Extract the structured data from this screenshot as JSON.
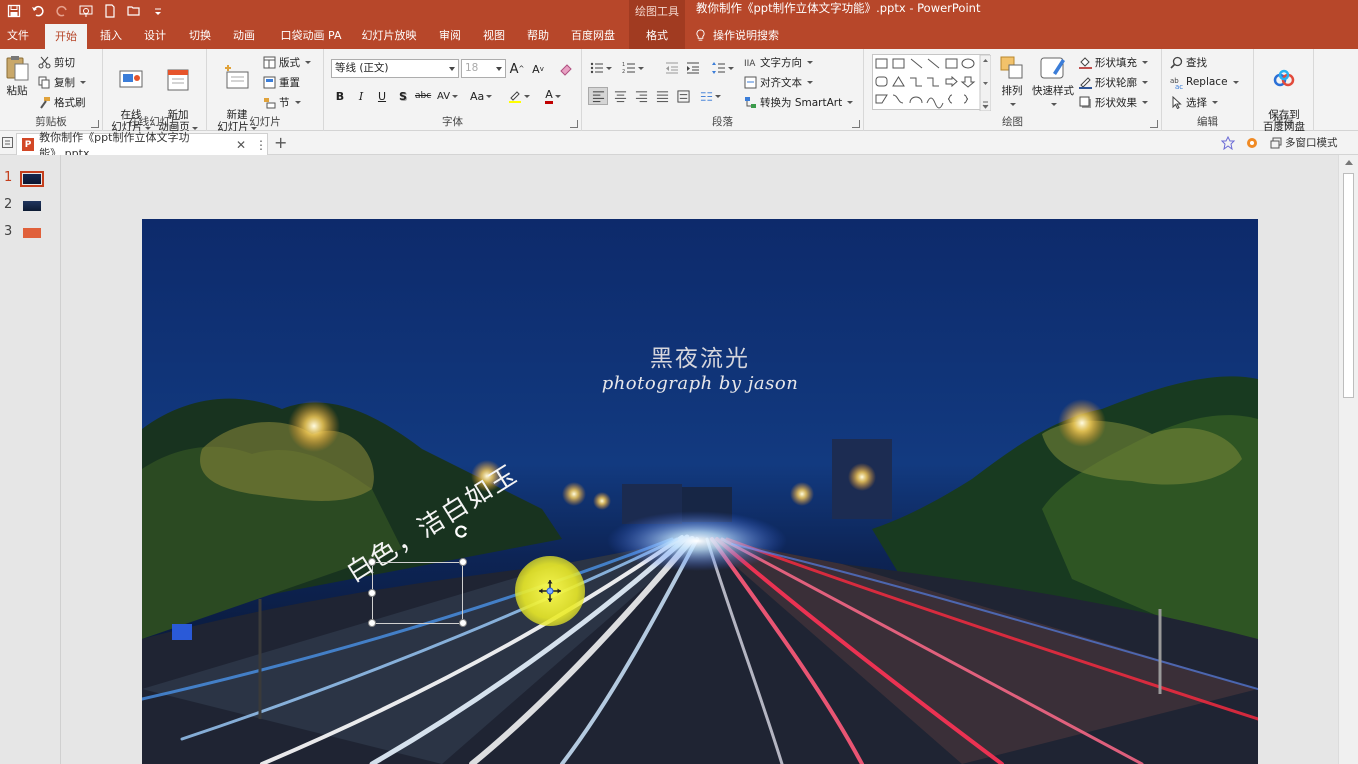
{
  "titlebar": {
    "context_label": "绘图工具",
    "document_title": "教你制作《ppt制作立体文字功能》.pptx  -  PowerPoint"
  },
  "tabs": [
    {
      "label": "文件"
    },
    {
      "label": "开始"
    },
    {
      "label": "插入"
    },
    {
      "label": "设计"
    },
    {
      "label": "切换"
    },
    {
      "label": "动画"
    },
    {
      "label": "口袋动画 PA"
    },
    {
      "label": "幻灯片放映"
    },
    {
      "label": "审阅"
    },
    {
      "label": "视图"
    },
    {
      "label": "帮助"
    },
    {
      "label": "百度网盘"
    },
    {
      "label": "格式"
    }
  ],
  "tellme": "操作说明搜索",
  "ribbon": {
    "clipboard": {
      "paste": "粘贴",
      "cut": "剪切",
      "copy": "复制",
      "format_painter": "格式刷",
      "label": "剪贴板"
    },
    "online_slides": {
      "online": "在线\n幻灯片",
      "new_anim": "新加\n动画页",
      "label": "在线幻灯片"
    },
    "slides": {
      "new_slide": "新建\n幻灯片",
      "layout": "版式",
      "reset": "重置",
      "section": "节",
      "label": "幻灯片"
    },
    "font": {
      "font_name": "等线 (正文)",
      "font_size": "18",
      "bold": "B",
      "italic": "I",
      "underline": "U",
      "shadow": "S",
      "strike": "abc",
      "spacing": "AV",
      "case": "Aa",
      "color": "A",
      "grow": "A",
      "shrink": "A",
      "label": "字体"
    },
    "paragraph": {
      "text_direction": "文字方向",
      "align_text": "对齐文本",
      "smartart": "转换为 SmartArt",
      "label": "段落"
    },
    "drawing": {
      "arrange": "排列",
      "quick_styles": "快速样式",
      "fill": "形状填充",
      "outline": "形状轮廓",
      "effects": "形状效果",
      "label": "绘图"
    },
    "editing": {
      "find": "查找",
      "replace": "Replace",
      "select": "选择",
      "label": "编辑"
    },
    "save": {
      "save_to": "保存到\n百度网盘",
      "label": "保存"
    }
  },
  "doc_tab": {
    "name": "教你制作《ppt制作立体文字功能》.pptx",
    "multiwindow": "多窗口模式"
  },
  "slides_panel": [
    {
      "number": "1"
    },
    {
      "number": "2"
    },
    {
      "number": "3"
    }
  ],
  "slide": {
    "title": "黑夜流光",
    "subtitle": "photograph by jason",
    "rotated_text": "白色，洁白如玉"
  }
}
